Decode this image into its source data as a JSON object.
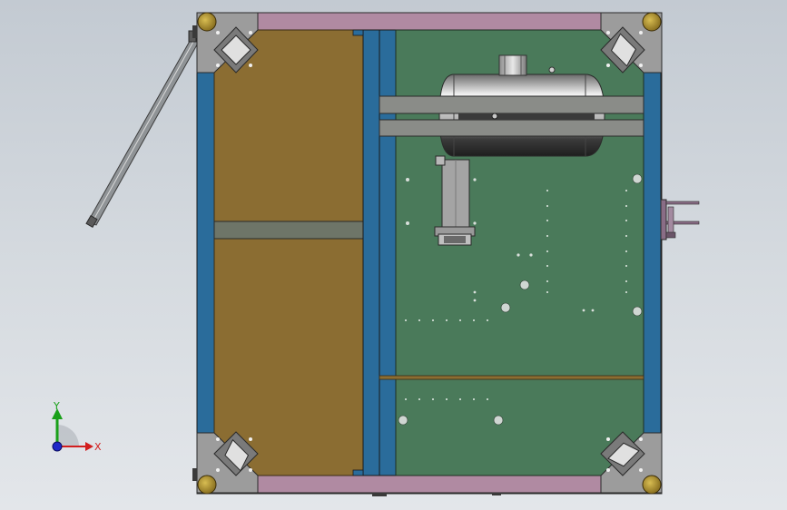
{
  "viewport": {
    "background_top": "#c3cad2",
    "background_bottom": "#e3e6ea"
  },
  "triad": {
    "x_label": "X",
    "y_label": "Y",
    "x_color": "#d21e1e",
    "y_color": "#19a019",
    "z_color": "#1e28c8"
  },
  "model": {
    "frame_color": "#2a6c9b",
    "rail_color": "#b08aa2",
    "wood_panel_color": "#8b6d32",
    "circuit_board_color": "#4a7a5a",
    "corner_plate_color": "#9c9c9c",
    "caster_color": "#b89a2e",
    "tank_color": "#b4b4b4",
    "brace_color": "#8a8c88"
  }
}
